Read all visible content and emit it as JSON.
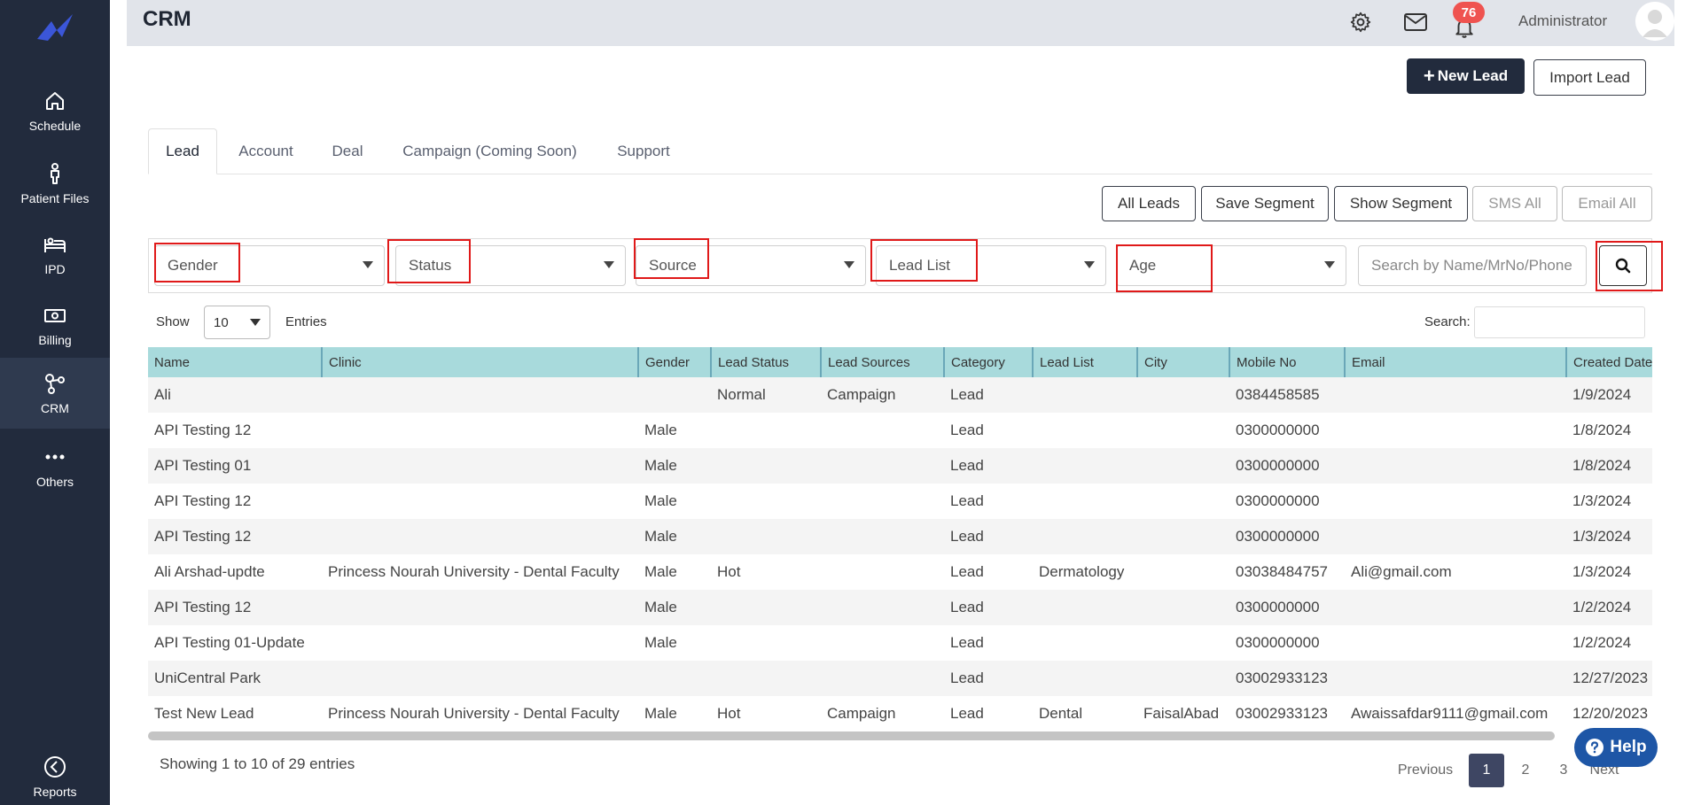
{
  "sidebar": {
    "items": [
      {
        "label": "Schedule",
        "icon": "home-icon"
      },
      {
        "label": "Patient Files",
        "icon": "person-icon"
      },
      {
        "label": "IPD",
        "icon": "bed-icon"
      },
      {
        "label": "Billing",
        "icon": "money-icon"
      },
      {
        "label": "CRM",
        "icon": "crm-icon"
      },
      {
        "label": "Others",
        "icon": "more-dots-icon"
      },
      {
        "label": "Reports",
        "icon": "back-circle-icon"
      }
    ],
    "active": "CRM"
  },
  "header": {
    "title": "CRM",
    "notification_count": "76",
    "user_name": "Administrator"
  },
  "actions": {
    "new_lead": "New Lead",
    "import_lead": "Import Lead"
  },
  "tabs": [
    {
      "label": "Lead"
    },
    {
      "label": "Account"
    },
    {
      "label": "Deal"
    },
    {
      "label": "Campaign (Coming Soon)"
    },
    {
      "label": "Support"
    }
  ],
  "segment_buttons": {
    "all_leads": "All Leads",
    "save_segment": "Save Segment",
    "show_segment": "Show Segment",
    "sms_all": "SMS All",
    "email_all": "Email All"
  },
  "filters": {
    "gender": "Gender",
    "status": "Status",
    "source": "Source",
    "lead_list": "Lead List",
    "age": "Age",
    "search_placeholder": "Search by Name/MrNo/Phone"
  },
  "table_controls": {
    "show": "Show",
    "entries_value": "10",
    "entries": "Entries",
    "search_label": "Search:"
  },
  "table": {
    "columns": [
      "Name",
      "Clinic",
      "Gender",
      "Lead Status",
      "Lead Sources",
      "Category",
      "Lead List",
      "City",
      "Mobile No",
      "Email",
      "Created Date"
    ],
    "rows": [
      [
        "Ali",
        "",
        "",
        "Normal",
        "Campaign",
        "Lead",
        "",
        "",
        "0384458585",
        "",
        "1/9/2024"
      ],
      [
        "API Testing 12",
        "",
        "Male",
        "",
        "",
        "Lead",
        "",
        "",
        "0300000000",
        "",
        "1/8/2024"
      ],
      [
        "API Testing 01",
        "",
        "Male",
        "",
        "",
        "Lead",
        "",
        "",
        "0300000000",
        "",
        "1/8/2024"
      ],
      [
        "API Testing 12",
        "",
        "Male",
        "",
        "",
        "Lead",
        "",
        "",
        "0300000000",
        "",
        "1/3/2024"
      ],
      [
        "API Testing 12",
        "",
        "Male",
        "",
        "",
        "Lead",
        "",
        "",
        "0300000000",
        "",
        "1/3/2024"
      ],
      [
        "Ali Arshad-updte",
        "Princess Nourah University - Dental Faculty",
        "Male",
        "Hot",
        "",
        "Lead",
        "Dermatology",
        "",
        "03038484757",
        "Ali@gmail.com",
        "1/3/2024"
      ],
      [
        "API Testing 12",
        "",
        "Male",
        "",
        "",
        "Lead",
        "",
        "",
        "0300000000",
        "",
        "1/2/2024"
      ],
      [
        "API Testing 01-Update",
        "",
        "Male",
        "",
        "",
        "Lead",
        "",
        "",
        "0300000000",
        "",
        "1/2/2024"
      ],
      [
        "UniCentral Park",
        "",
        "",
        "",
        "",
        "Lead",
        "",
        "",
        "03002933123",
        "",
        "12/27/2023"
      ],
      [
        "Test New Lead",
        "Princess Nourah University - Dental Faculty",
        "Male",
        "Hot",
        "Campaign",
        "Lead",
        "Dental",
        "FaisalAbad",
        "03002933123",
        "Awaissafdar9111@gmail.com",
        "12/20/2023"
      ]
    ]
  },
  "footer": {
    "showing": "Showing 1 to 10 of 29 entries",
    "previous": "Previous",
    "pages": [
      "1",
      "2",
      "3"
    ],
    "next": "Next",
    "help": "Help"
  },
  "colors": {
    "sidebar": "#222b3d",
    "table_header": "#a8dadc",
    "highlight": "#e01919",
    "badge": "#ef5350",
    "help_button": "#1e56a6"
  }
}
